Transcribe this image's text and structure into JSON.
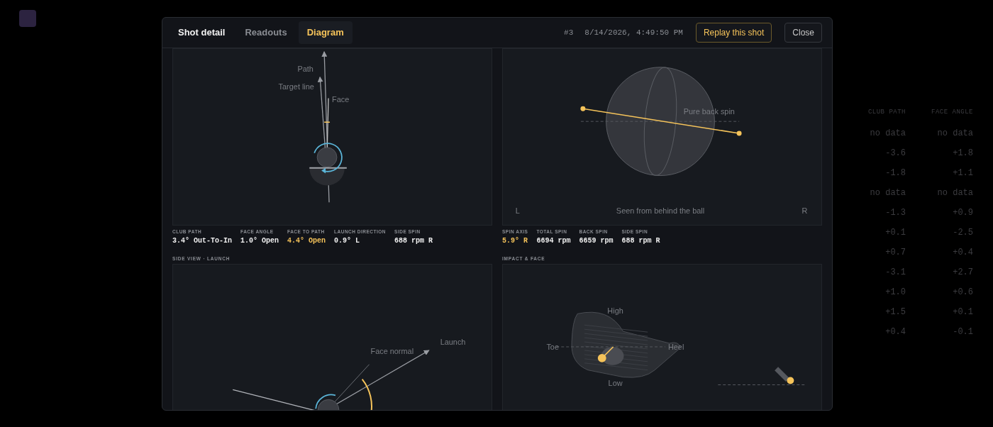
{
  "backdrop": {
    "columns": [
      "CLUB PATH",
      "FACE ANGLE"
    ],
    "rows": [
      [
        "no data",
        "no data"
      ],
      [
        "-3.6",
        "+1.8"
      ],
      [
        "-1.8",
        "+1.1"
      ],
      [
        "no data",
        "no data"
      ],
      [
        "-1.3",
        "+0.9"
      ],
      [
        "+0.1",
        "-2.5"
      ],
      [
        "+0.7",
        "+0.4"
      ],
      [
        "-3.1",
        "+2.7"
      ],
      [
        "+1.0",
        "+0.6"
      ],
      [
        "+1.5",
        "+0.1"
      ],
      [
        "+0.4",
        "-0.1"
      ]
    ]
  },
  "modal": {
    "tabs": [
      {
        "label": "Shot detail",
        "selected": false,
        "kind": "title"
      },
      {
        "label": "Readouts",
        "selected": false,
        "kind": "tab"
      },
      {
        "label": "Diagram",
        "selected": true,
        "kind": "tab"
      }
    ],
    "shot_number": "#3",
    "timestamp": "8/14/2026, 4:49:50 PM",
    "buttons": [
      {
        "label": "Replay this shot",
        "kind": "primary"
      },
      {
        "label": "Close",
        "kind": "secondary"
      }
    ]
  },
  "panels": [
    {
      "kind": "top_view",
      "labels": [
        "Path",
        "Target line",
        "Face"
      ],
      "readouts": [
        {
          "label": "CLUB PATH",
          "value": "3.4° Out-To-In",
          "highlight": false
        },
        {
          "label": "FACE ANGLE",
          "value": "1.0° Open",
          "highlight": false
        },
        {
          "label": "FACE TO PATH",
          "value": "4.4° Open",
          "highlight": true
        },
        {
          "label": "LAUNCH DIRECTION",
          "value": "0.9° L",
          "highlight": false
        },
        {
          "label": "SIDE SPIN",
          "value": "688 rpm R",
          "highlight": false
        }
      ]
    },
    {
      "kind": "spin_axis",
      "labels": [
        "Pure back spin",
        "L",
        "Seen from behind the ball",
        "R"
      ],
      "readouts": [
        {
          "label": "SPIN AXIS",
          "value": "5.9° R",
          "highlight": true
        },
        {
          "label": "TOTAL SPIN",
          "value": "6694 rpm",
          "highlight": false
        },
        {
          "label": "BACK SPIN",
          "value": "6659 rpm",
          "highlight": false
        },
        {
          "label": "SIDE SPIN",
          "value": "688 rpm R",
          "highlight": false
        }
      ]
    },
    {
      "kind": "side_view",
      "title": "SIDE VIEW · LAUNCH",
      "labels": [
        "Launch",
        "Face normal"
      ]
    },
    {
      "kind": "impact",
      "title": "IMPACT & FACE",
      "labels": [
        "High",
        "Toe",
        "Heel",
        "Low"
      ]
    }
  ]
}
